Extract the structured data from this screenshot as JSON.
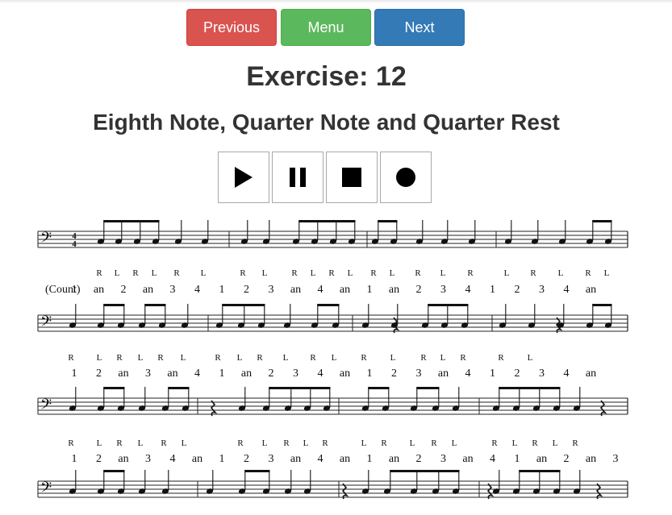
{
  "nav": {
    "previous_label": "Previous",
    "menu_label": "Menu",
    "next_label": "Next"
  },
  "exercise": {
    "title": "Exercise: 12",
    "subtitle": "Eighth Note, Quarter Note and Quarter Rest"
  },
  "playback": {
    "play_icon": "play-icon",
    "pause_icon": "pause-icon",
    "stop_icon": "stop-icon",
    "record_icon": "record-icon"
  },
  "sheet_music": {
    "time_signature": "4/4",
    "count_label": "(Count)",
    "lines": [
      {
        "sticking": [
          "R",
          "L",
          "R",
          "L",
          "R",
          "L",
          "R",
          "L",
          "R",
          "L",
          "R",
          "L",
          "R",
          "L",
          "R",
          "L",
          "R",
          "L",
          "R",
          "L",
          "R",
          "L",
          "R",
          "L",
          "R",
          "L"
        ],
        "counts": [
          "1",
          "an",
          "2",
          "an",
          "3",
          "4",
          "1",
          "2",
          "3",
          "an",
          "4",
          "an",
          "1",
          "an",
          "2",
          "3",
          "4",
          "1",
          "2",
          "3",
          "4",
          "an"
        ]
      },
      {
        "sticking": [
          "R",
          "L",
          "R",
          "L",
          "R",
          "L",
          "R",
          "L",
          "R",
          "L",
          "R",
          "L",
          "R",
          "L",
          "R",
          "L",
          "R",
          "R",
          "L"
        ],
        "counts": [
          "1",
          "2",
          "an",
          "3",
          "an",
          "4",
          "1",
          "an",
          "2",
          "3",
          "4",
          "an",
          "1",
          "2",
          "3",
          "an",
          "4",
          "1",
          "2",
          "3",
          "4",
          "an"
        ]
      },
      {
        "sticking": [
          "R",
          "L",
          "R",
          "L",
          "R",
          "L",
          "R",
          "L",
          "R",
          "L",
          "R",
          "L",
          "R",
          "L",
          "R",
          "L",
          "R",
          "L",
          "R",
          "L",
          "R",
          "L",
          "R",
          "L"
        ],
        "counts": [
          "1",
          "2",
          "an",
          "3",
          "4",
          "an",
          "1",
          "2",
          "3",
          "an",
          "4",
          "an",
          "1",
          "an",
          "2",
          "3",
          "an",
          "4",
          "1",
          "an",
          "2",
          "an",
          "3",
          "4"
        ]
      }
    ]
  }
}
